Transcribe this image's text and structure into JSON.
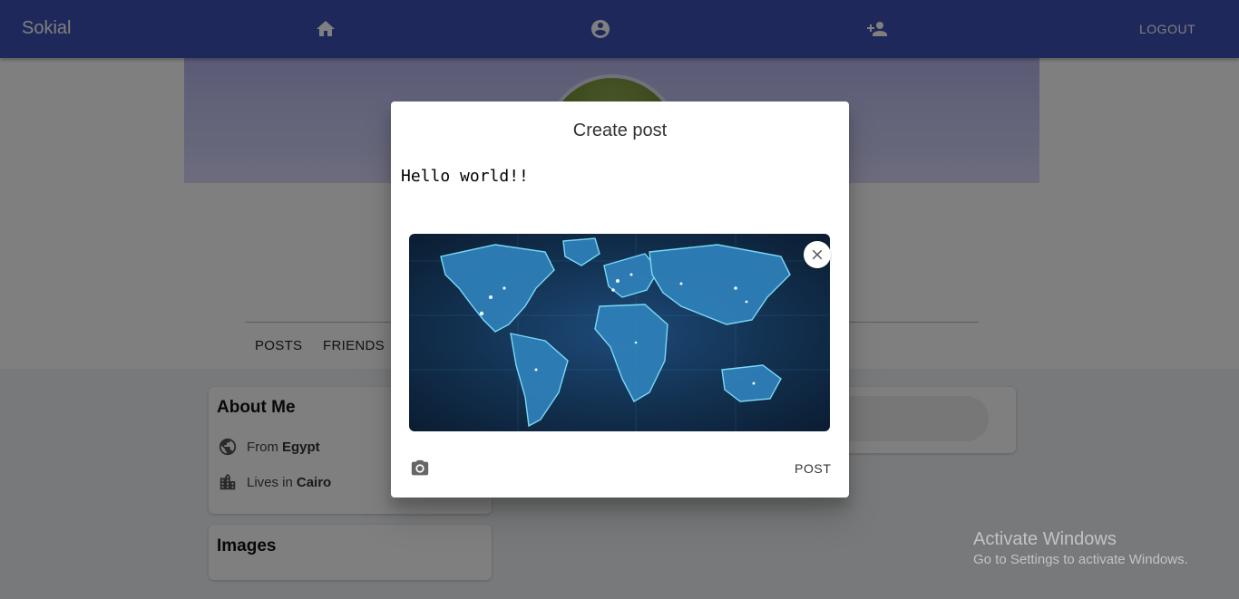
{
  "appbar": {
    "brand": "Sokial",
    "logout_label": "LOGOUT",
    "icons": [
      "home-icon",
      "account-circle-icon",
      "person-add-icon"
    ],
    "color": "#3f51b5"
  },
  "profile": {
    "tabs": [
      "POSTS",
      "FRIENDS"
    ]
  },
  "about": {
    "title": "About Me",
    "from_prefix": "From",
    "from_value": "Egypt",
    "lives_prefix": "Lives in",
    "lives_value": "Cairo"
  },
  "images_card": {
    "title": "Images"
  },
  "dialog": {
    "title": "Create post",
    "text": "Hello world!!",
    "post_label": "POST",
    "image_subject": "world-map-image"
  },
  "watermark": {
    "title": "Activate Windows",
    "subtitle": "Go to Settings to activate Windows."
  }
}
